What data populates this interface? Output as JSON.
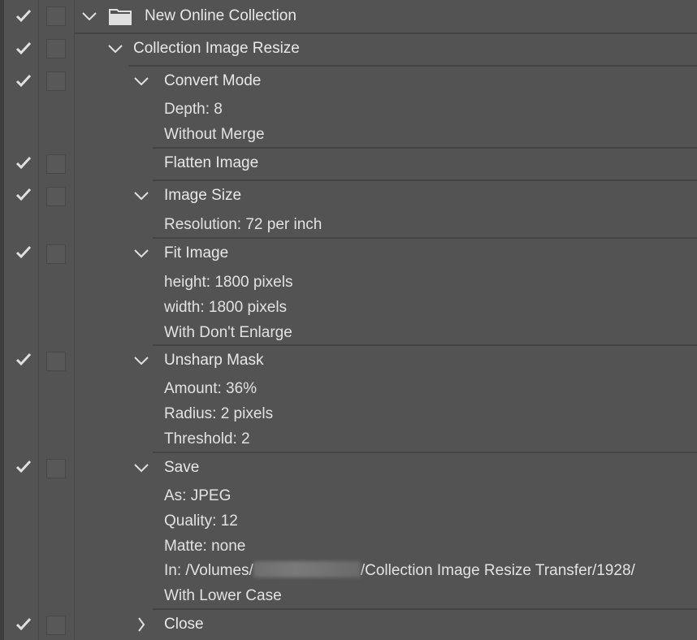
{
  "actions_panel": {
    "set": {
      "name": "New Online Collection",
      "icon": "folder-icon",
      "expanded": true
    },
    "action": {
      "name": "Collection Image Resize",
      "expanded": true
    },
    "steps": [
      {
        "name": "Convert Mode",
        "expanded": true,
        "params": [
          "Depth: 8",
          "Without Merge"
        ]
      },
      {
        "name": "Flatten Image",
        "expanded": null,
        "params": []
      },
      {
        "name": "Image Size",
        "expanded": true,
        "params": [
          "Resolution: 72 per inch"
        ]
      },
      {
        "name": "Fit Image",
        "expanded": true,
        "params": [
          "height: 1800 pixels",
          "width: 1800 pixels",
          "With Don't Enlarge"
        ]
      },
      {
        "name": "Unsharp Mask",
        "expanded": true,
        "params": [
          "Amount: 36%",
          "Radius: 2 pixels",
          "Threshold: 2"
        ]
      },
      {
        "name": "Save",
        "expanded": true,
        "params": [
          "As: JPEG",
          "Quality: 12",
          "Matte: none"
        ],
        "path_prefix": "In: /Volumes/",
        "path_suffix": "/Collection Image Resize Transfer/1928/",
        "after_path": "With Lower Case"
      },
      {
        "name": "Close",
        "expanded": false,
        "params": []
      }
    ]
  },
  "colors": {
    "background": "#535353",
    "separator": "#434343",
    "text": "#e8e8e8"
  }
}
